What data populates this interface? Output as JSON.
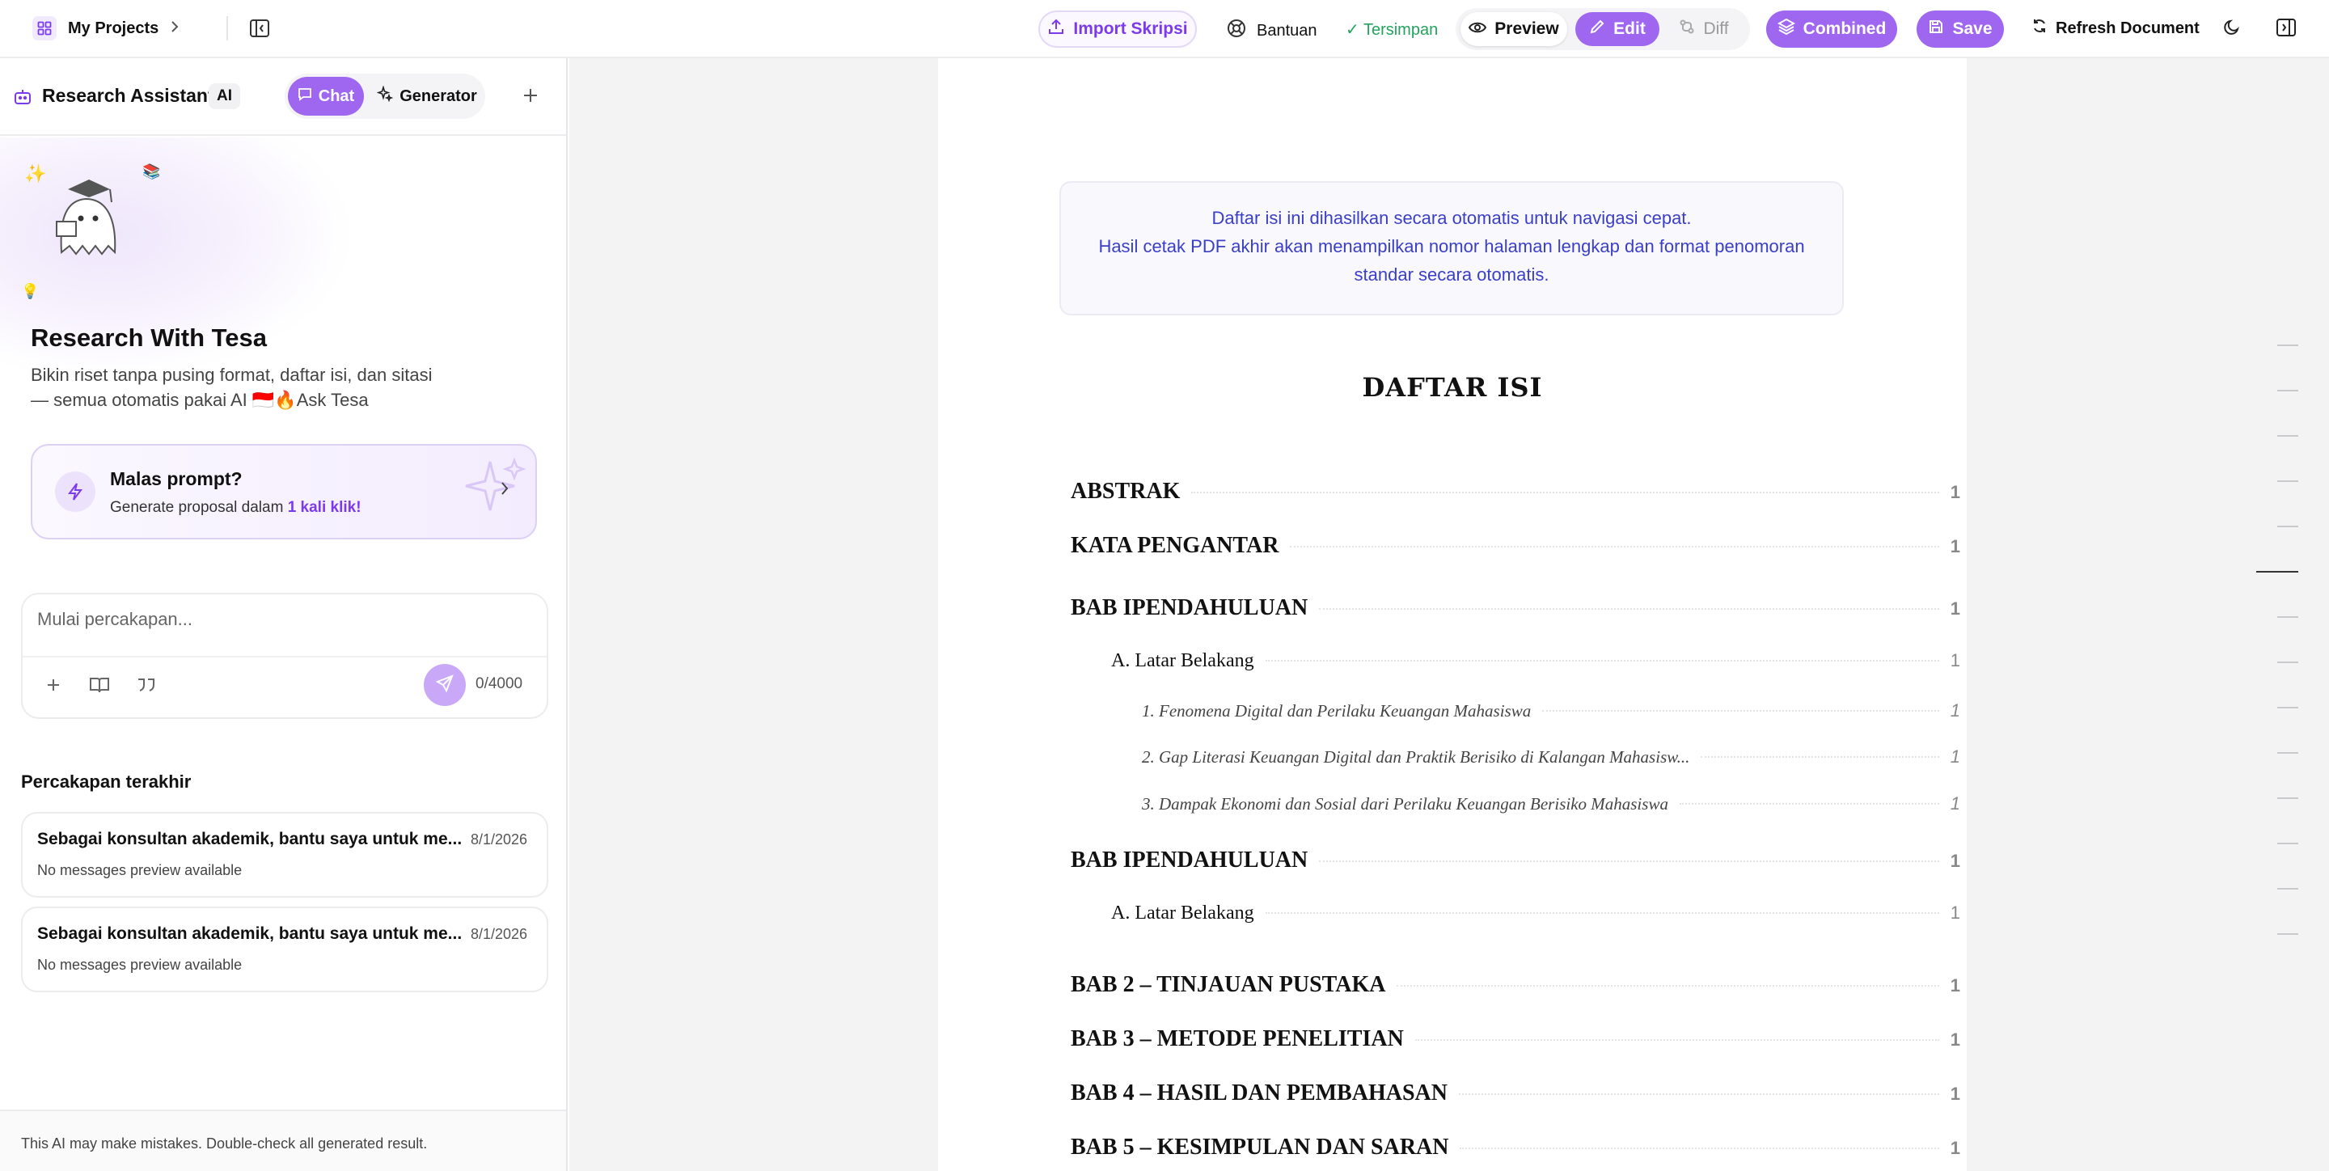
{
  "topbar": {
    "projects_label": "My Projects",
    "import_label": "Import Skripsi",
    "help_label": "Bantuan",
    "saved_label": "✓ Tersimpan",
    "preview_label": "Preview",
    "edit_label": "Edit",
    "diff_label": "Diff",
    "combined_label": "Combined",
    "save_label": "Save",
    "refresh_label": "Refresh Document"
  },
  "sidebar": {
    "title": "Research Assistant",
    "ai_badge": "AI",
    "tab_chat": "Chat",
    "tab_generator": "Generator",
    "hero_title": "Research With Tesa",
    "hero_desc_1": "Bikin riset tanpa pusing format, daftar isi, dan sitasi",
    "hero_desc_2": "— semua otomatis pakai AI 🇮🇩🔥Ask Tesa",
    "card_title": "Malas prompt?",
    "card_desc_prefix": "Generate proposal dalam ",
    "card_desc_highlight": "1 kali klik!",
    "input_placeholder": "Mulai percakapan...",
    "char_count": "0/4000",
    "recent_heading": "Percakapan terakhir",
    "conversations": [
      {
        "title": "Sebagai konsultan akademik, bantu saya untuk me...",
        "date": "8/1/2026",
        "preview": "No messages preview available"
      },
      {
        "title": "Sebagai konsultan akademik, bantu saya untuk me...",
        "date": "8/1/2026",
        "preview": "No messages preview available"
      }
    ],
    "disclaimer": "This AI may make mistakes. Double-check all generated result."
  },
  "document": {
    "notice_line1": "Daftar isi ini dihasilkan secara otomatis untuk navigasi cepat.",
    "notice_line2": "Hasil cetak PDF akhir akan menampilkan nomor halaman lengkap dan format penomoran",
    "notice_line3": "standar secara otomatis.",
    "toc_title": "DAFTAR ISI",
    "toc": [
      {
        "text": "ABSTRAK",
        "page": "1"
      },
      {
        "text": "KATA PENGANTAR",
        "page": "1"
      },
      {
        "text": "BAB IPENDAHULUAN",
        "page": "1"
      },
      {
        "text": "A. Latar Belakang",
        "page": "1"
      },
      {
        "text": "1. Fenomena Digital dan Perilaku Keuangan Mahasiswa",
        "page": "1"
      },
      {
        "text": "2. Gap Literasi Keuangan Digital dan Praktik Berisiko di Kalangan Mahasisw...",
        "page": "1"
      },
      {
        "text": "3. Dampak Ekonomi dan Sosial dari Perilaku Keuangan Berisiko Mahasiswa",
        "page": "1"
      },
      {
        "text": "BAB IPENDAHULUAN",
        "page": "1"
      },
      {
        "text": "A. Latar Belakang",
        "page": "1"
      },
      {
        "text": "BAB 2 – TINJAUAN PUSTAKA",
        "page": "1"
      },
      {
        "text": "BAB 3 – METODE PENELITIAN",
        "page": "1"
      },
      {
        "text": "BAB 4 – HASIL DAN PEMBAHASAN",
        "page": "1"
      },
      {
        "text": "BAB 5 – KESIMPULAN DAN SARAN",
        "page": "1"
      }
    ]
  },
  "colors": {
    "accent": "#7c3aed",
    "accent_light": "#9f67f0",
    "notice_text": "#3b3fc6",
    "saved_green": "#22a45d"
  }
}
